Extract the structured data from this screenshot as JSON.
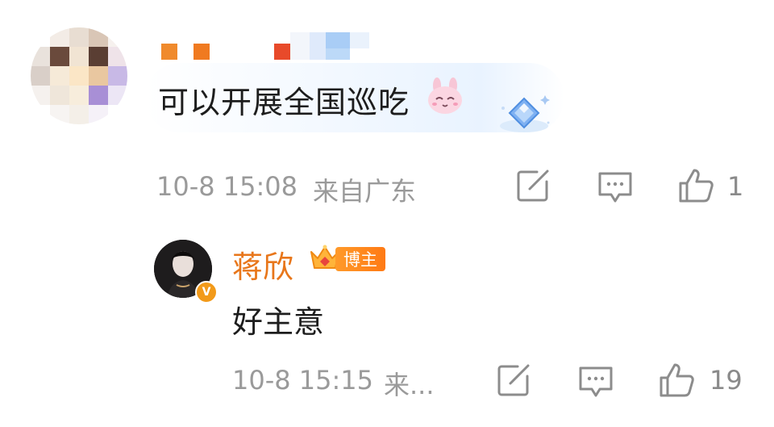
{
  "comment": {
    "text": "可以开展全国巡吃",
    "timestamp": "10-8 15:08",
    "location": "来自广东",
    "like_count": "1",
    "emoji": "bunny-emoji",
    "badge_icon": "diamond-gem-icon"
  },
  "reply": {
    "author": "蒋欣",
    "author_badge": "博主",
    "text": "好主意",
    "timestamp": "10-8 15:15",
    "location_truncated": "来...",
    "like_count": "19",
    "verified_mark": "V"
  },
  "colors": {
    "author_name": "#e8761a",
    "meta_text": "#9a9a9a",
    "badge_bg": "#ff8a1f",
    "verified_badge": "#f29a1a"
  }
}
